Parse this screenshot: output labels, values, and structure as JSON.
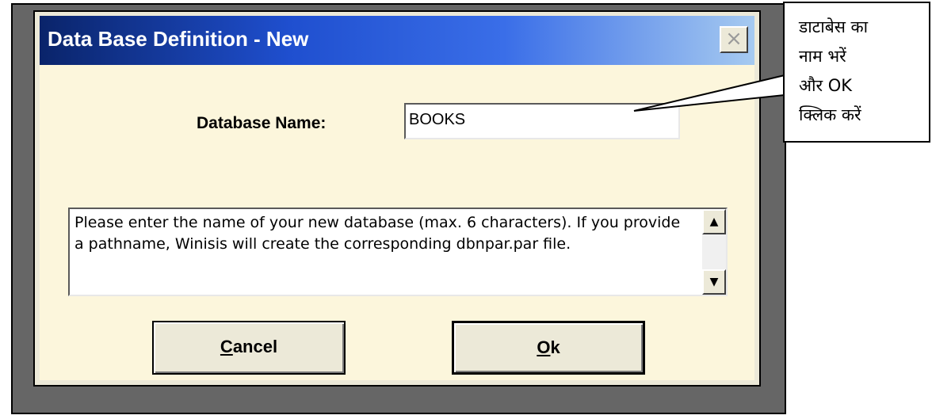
{
  "dialog": {
    "title": "Data Base Definition - New",
    "close_icon": "close-icon",
    "database_name_label": "Database Name:",
    "database_name_value": "BOOKS",
    "info_text": "Please enter the name of your new database (max. 6 characters). If you provide a pathname, Winisis will create the corresponding dbnpar.par file.",
    "scroll_up_icon": "scroll-up-arrow-icon",
    "scroll_down_icon": "scroll-down-arrow-icon",
    "cancel_rest": "ancel",
    "cancel_access_key": "C",
    "ok_rest": "k",
    "ok_access_key": "O"
  },
  "callout": {
    "lines": [
      "डाटाबेस का",
      "नाम भरें",
      "और OK",
      "क्लिक करें"
    ]
  },
  "colors": {
    "title_gradient_start": "#0a246a",
    "title_gradient_end": "#a6caf0",
    "client_background": "#fcf6dc",
    "backdrop": "#666666"
  }
}
